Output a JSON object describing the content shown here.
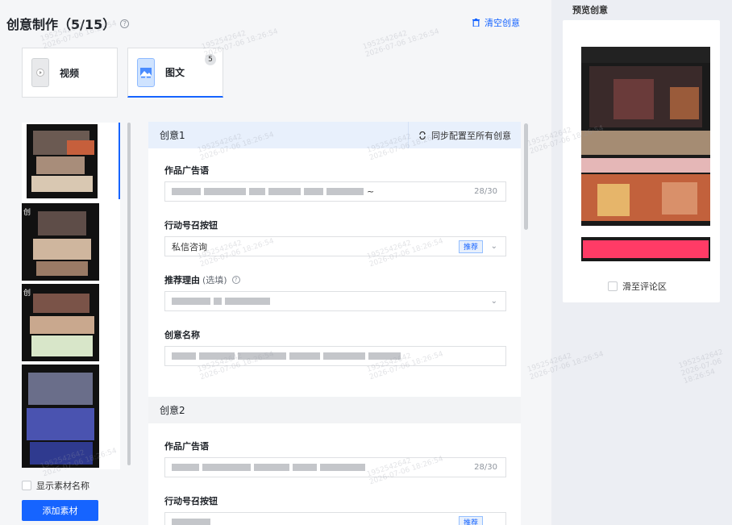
{
  "header": {
    "title": "创意制作（5/15）",
    "help_icon": "?",
    "clear_label": "清空创意"
  },
  "type_tabs": [
    {
      "label": "视频",
      "icon": "video-icon"
    },
    {
      "label": "图文",
      "icon": "image-icon",
      "badge": "5"
    }
  ],
  "materials": {
    "show_name_label": "显示素材名称",
    "add_button": "添加素材",
    "item_prefix": "创"
  },
  "creatives": [
    {
      "title": "创意1",
      "sync_label": "同步配置至所有创意",
      "fields": {
        "ad_slogan_label": "作品广告语",
        "ad_slogan_suffix": "~",
        "ad_slogan_counter": "28/30",
        "cta_label": "行动号召按钮",
        "cta_value": "私信咨询",
        "cta_tag": "推荐",
        "reason_label": "推荐理由",
        "reason_optional": "(选填)",
        "name_label": "创意名称"
      }
    },
    {
      "title": "创意2",
      "fields": {
        "ad_slogan_label": "作品广告语",
        "ad_slogan_counter": "28/30",
        "cta_label": "行动号召按钮",
        "cta_tag": "推荐"
      }
    }
  ],
  "preview": {
    "title": "预览创意",
    "slide_comment_label": "滑至评论区"
  },
  "watermark": {
    "line1": "1952542642",
    "line2": "2026-07-06 18:26:54"
  }
}
